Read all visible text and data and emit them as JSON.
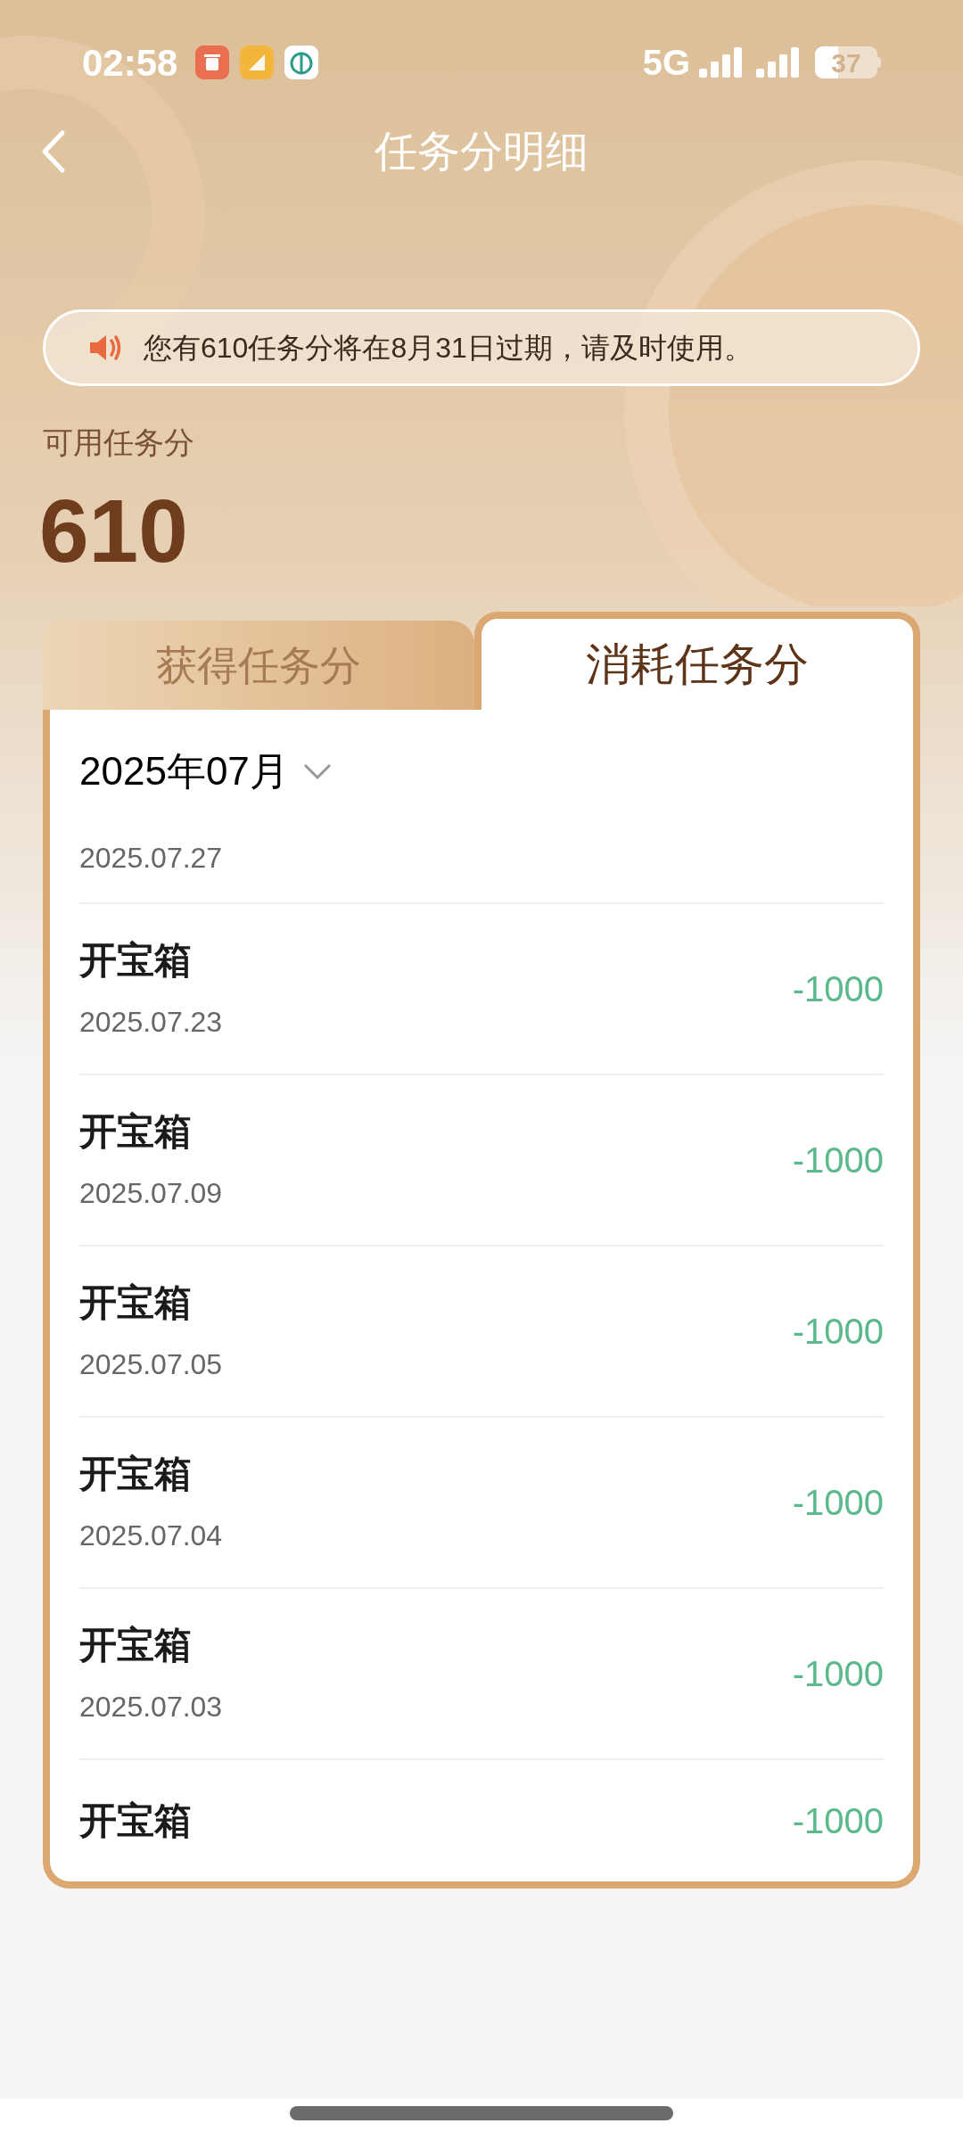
{
  "status_bar": {
    "time": "02:58",
    "network": "5G",
    "battery": "37"
  },
  "header": {
    "title": "任务分明细"
  },
  "notice": {
    "text": "您有610任务分将在8月31日过期，请及时使用。"
  },
  "balance": {
    "label": "可用任务分",
    "value": "610"
  },
  "tabs": [
    {
      "label": "获得任务分",
      "selected": false
    },
    {
      "label": "消耗任务分",
      "selected": true
    }
  ],
  "month_picker": {
    "value": "2025年07月"
  },
  "records": [
    {
      "date": "2025.07.27"
    },
    {
      "title": "开宝箱",
      "date": "2025.07.23",
      "amount": "-1000"
    },
    {
      "title": "开宝箱",
      "date": "2025.07.09",
      "amount": "-1000"
    },
    {
      "title": "开宝箱",
      "date": "2025.07.05",
      "amount": "-1000"
    },
    {
      "title": "开宝箱",
      "date": "2025.07.04",
      "amount": "-1000"
    },
    {
      "title": "开宝箱",
      "date": "2025.07.03",
      "amount": "-1000"
    },
    {
      "title": "开宝箱",
      "amount": "-1000"
    }
  ]
}
